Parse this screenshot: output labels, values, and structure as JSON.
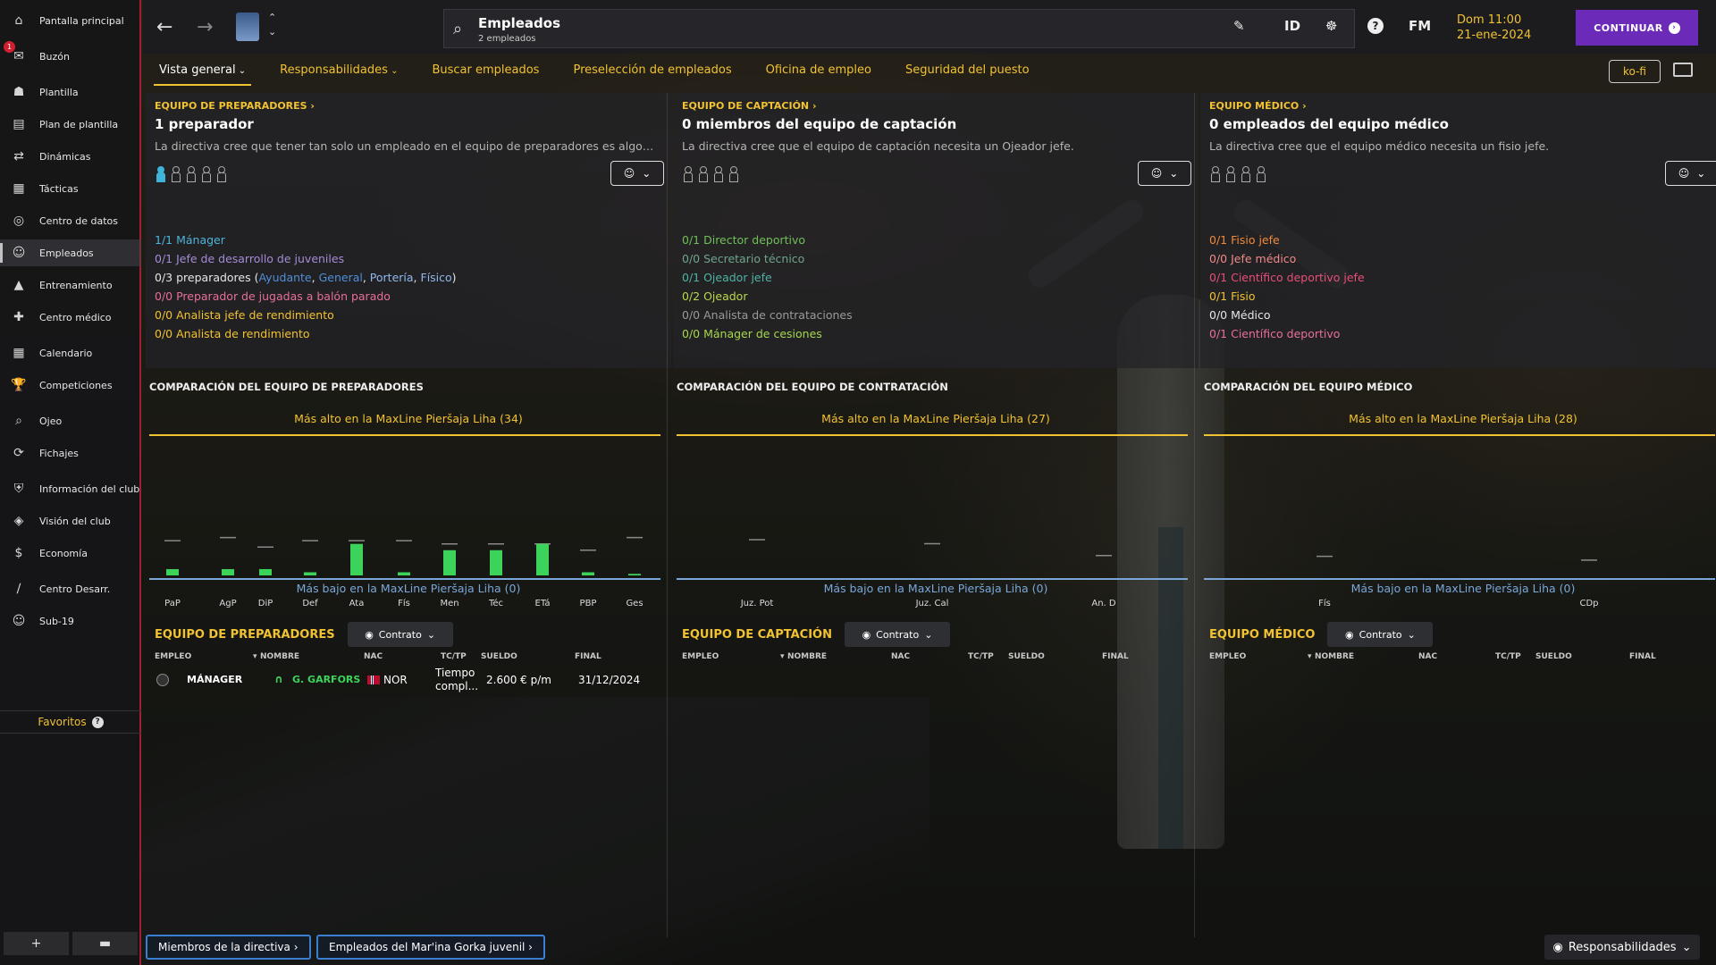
{
  "colors": {
    "accent": "#f1c232",
    "continue": "#6b2bb8",
    "sidebar_border": "#a02030",
    "bar": "#3cd35a",
    "low_line": "#7aa6d8"
  },
  "sidebar": {
    "items": [
      {
        "label": "Pantalla principal",
        "icon": "home-icon"
      },
      {
        "label": "Buzón",
        "icon": "inbox-icon",
        "badge": "1"
      },
      {
        "label": "Plantilla",
        "icon": "squad-icon"
      },
      {
        "label": "Plan de plantilla",
        "icon": "clipboard-icon"
      },
      {
        "label": "Dinámicas",
        "icon": "dynamics-icon"
      },
      {
        "label": "Tácticas",
        "icon": "tactics-icon"
      },
      {
        "label": "Centro de datos",
        "icon": "data-icon"
      },
      {
        "label": "Empleados",
        "icon": "staff-icon",
        "active": true
      },
      {
        "label": "Entrenamiento",
        "icon": "training-icon"
      },
      {
        "label": "Centro médico",
        "icon": "medical-icon"
      },
      {
        "label": "Calendario",
        "icon": "calendar-icon"
      },
      {
        "label": "Competiciones",
        "icon": "trophy-icon"
      },
      {
        "label": "Ojeo",
        "icon": "scouting-icon"
      },
      {
        "label": "Fichajes",
        "icon": "transfers-icon"
      },
      {
        "label": "Información del club",
        "icon": "club-info-icon"
      },
      {
        "label": "Visión del club",
        "icon": "club-vision-icon"
      },
      {
        "label": "Economía",
        "icon": "finances-icon"
      },
      {
        "label": "Centro Desarr.",
        "icon": "development-icon"
      },
      {
        "label": "Sub-19",
        "icon": "u19-icon"
      }
    ],
    "favorites": "Favoritos"
  },
  "topbar": {
    "title": "Empleados",
    "subtitle": "2 empleados",
    "id_label": "ID",
    "fm_label": "FM",
    "time": "Dom 11:00",
    "date": "21-ene-2024",
    "continue": "CONTINUAR"
  },
  "tabs": [
    {
      "label": "Vista general",
      "active": true,
      "dropdown": true
    },
    {
      "label": "Responsabilidades",
      "dropdown": true
    },
    {
      "label": "Buscar empleados"
    },
    {
      "label": "Preselección de empleados"
    },
    {
      "label": "Oficina de empleo"
    },
    {
      "label": "Seguridad del puesto"
    }
  ],
  "kofi": "ko-fi",
  "columns": [
    {
      "section": "EQUIPO DE PREPARADORES",
      "title": "1 preparador",
      "desc": "La directiva cree que tener tan solo un empleado en el equipo de preparadores es algo poc...",
      "people_total": 5,
      "people_filled": 1,
      "roles": [
        {
          "parts": [
            {
              "t": "1/1 Mánager",
              "c": "#4fb3d9"
            }
          ]
        },
        {
          "parts": [
            {
              "t": "0/1 Jefe de desarrollo de juveniles",
              "c": "#a58cd8"
            }
          ]
        },
        {
          "parts": [
            {
              "t": "0/3 preparadores (",
              "c": "#e6e6e6"
            },
            {
              "t": "Ayudante",
              "c": "#4f8fd8"
            },
            {
              "t": ", ",
              "c": "#e6e6e6"
            },
            {
              "t": "General",
              "c": "#4f8fd8"
            },
            {
              "t": ", ",
              "c": "#e6e6e6"
            },
            {
              "t": "Portería",
              "c": "#8fb8ef"
            },
            {
              "t": ", ",
              "c": "#e6e6e6"
            },
            {
              "t": "Físico",
              "c": "#8fb8ef"
            },
            {
              "t": ")",
              "c": "#e6e6e6"
            }
          ]
        },
        {
          "parts": [
            {
              "t": "0/0 Preparador de jugadas a balón parado",
              "c": "#e76f9a"
            }
          ]
        },
        {
          "parts": [
            {
              "t": "0/0 Analista jefe de rendimiento",
              "c": "#f1c232"
            }
          ]
        },
        {
          "parts": [
            {
              "t": "0/0 Analista de rendimiento",
              "c": "#f1c232"
            }
          ]
        }
      ],
      "chart_title": "COMPARACIÓN DEL EQUIPO DE PREPARADORES",
      "high_label": "Más alto en la MaxLine Pieršaja Liha (34)",
      "low_label": "Más bajo en la MaxLine Pieršaja Liha (0)",
      "table_title": "EQUIPO DE PREPARADORES",
      "rows": [
        {
          "role": "MÁNAGER",
          "name": "G. GARFORS",
          "nat": "NOR",
          "type": "Tiempo compl...",
          "wage": "2.600 € p/m",
          "end": "31/12/2024"
        }
      ]
    },
    {
      "section": "EQUIPO DE CAPTACIÓN",
      "title": "0 miembros del equipo de captación",
      "desc": "La directiva cree que el equipo de captación necesita un Ojeador jefe.",
      "people_total": 4,
      "people_filled": 0,
      "roles": [
        {
          "parts": [
            {
              "t": "0/1 Director deportivo",
              "c": "#6fbf5a"
            }
          ]
        },
        {
          "parts": [
            {
              "t": "0/0 Secretario técnico",
              "c": "#6fa48c"
            }
          ]
        },
        {
          "parts": [
            {
              "t": "0/1 Ojeador jefe",
              "c": "#4fb3a6"
            }
          ]
        },
        {
          "parts": [
            {
              "t": "0/2 Ojeador",
              "c": "#b8d84f"
            }
          ]
        },
        {
          "parts": [
            {
              "t": "0/0 Analista de contrataciones",
              "c": "#9a9a9a"
            }
          ]
        },
        {
          "parts": [
            {
              "t": "0/0 Mánager de cesiones",
              "c": "#a6d84f"
            }
          ]
        }
      ],
      "chart_title": "COMPARACIÓN DEL EQUIPO DE CONTRATACIÓN",
      "high_label": "Más alto en la MaxLine Pieršaja Liha (27)",
      "low_label": "Más bajo en la MaxLine Pieršaja Liha (0)",
      "table_title": "EQUIPO DE CAPTACIÓN",
      "rows": []
    },
    {
      "section": "EQUIPO MÉDICO",
      "title": "0 empleados del equipo médico",
      "desc": "La directiva cree que el equipo médico necesita un fisio jefe.",
      "people_total": 4,
      "people_filled": 0,
      "roles": [
        {
          "parts": [
            {
              "t": "0/1 Fisio jefe",
              "c": "#f08a3c"
            }
          ]
        },
        {
          "parts": [
            {
              "t": "0/0 Jefe médico",
              "c": "#f08a8a"
            }
          ]
        },
        {
          "parts": [
            {
              "t": "0/1 Científico deportivo jefe",
              "c": "#e84f7a"
            }
          ]
        },
        {
          "parts": [
            {
              "t": "0/1 Fisio",
              "c": "#f1c232"
            }
          ]
        },
        {
          "parts": [
            {
              "t": "0/0 Médico",
              "c": "#e6e6e6"
            }
          ]
        },
        {
          "parts": [
            {
              "t": "0/1 Científico deportivo",
              "c": "#e86f9a"
            }
          ]
        }
      ],
      "chart_title": "COMPARACIÓN DEL EQUIPO MÉDICO",
      "high_label": "Más alto en la MaxLine Pieršaja Liha (28)",
      "low_label": "Más bajo en la MaxLine Pieršaja Liha (0)",
      "table_title": "EQUIPO MÉDICO",
      "rows": []
    }
  ],
  "table_labels": {
    "contract": "Contrato",
    "cols": [
      "EMPLEO",
      "NOMBRE",
      "NAC",
      "TC/TP",
      "SUELDO",
      "FINAL"
    ]
  },
  "chart_data": [
    {
      "type": "bar",
      "categories": [
        "PaP",
        "AgP",
        "DiP",
        "Def",
        "Ata",
        "Fís",
        "Men",
        "Téc",
        "ETá",
        "PBP",
        "Ges"
      ],
      "series": [
        {
          "values": [
            2,
            2,
            2,
            1,
            10,
            1,
            8,
            8,
            10,
            1,
            0.5
          ]
        }
      ],
      "league_avg": [
        11,
        12,
        9,
        11,
        11,
        11,
        10,
        10,
        10,
        8,
        12
      ],
      "ylim": [
        0,
        34
      ],
      "high": 34,
      "low": 0
    },
    {
      "type": "bar",
      "categories": [
        "Juz. Pot",
        "Juz. Cal",
        "An. D"
      ],
      "series": [
        {
          "values": [
            0,
            0,
            0
          ]
        }
      ],
      "league_avg": [
        9,
        8,
        5
      ],
      "ylim": [
        0,
        27
      ],
      "high": 27,
      "low": 0
    },
    {
      "type": "bar",
      "categories": [
        "Fís",
        "CDp"
      ],
      "series": [
        {
          "values": [
            0,
            0
          ]
        }
      ],
      "league_avg": [
        5,
        4
      ],
      "ylim": [
        0,
        28
      ],
      "high": 28,
      "low": 0
    }
  ],
  "bottom": {
    "directiva": "Miembros de la directiva",
    "juvenil": "Empleados del Mar'ina Gorka juvenil",
    "resp": "Responsabilidades"
  }
}
